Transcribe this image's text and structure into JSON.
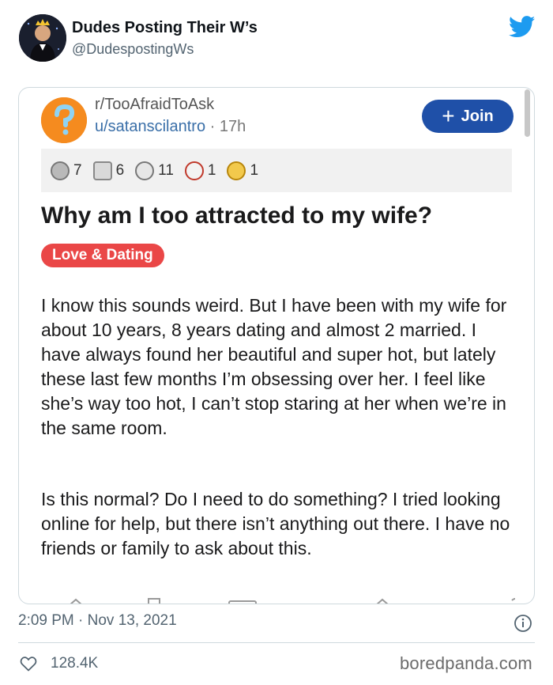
{
  "author": {
    "name": "Dudes Posting Their W’s",
    "handle": "@DudespostingWs"
  },
  "embedded_post": {
    "subreddit": "r/TooAfraidToAsk",
    "username": "u/satanscilantro",
    "separator": "·",
    "age": "17h",
    "join_label": "Join",
    "awards": [
      {
        "icon": "silver-award-icon",
        "count": "7"
      },
      {
        "icon": "helpful-award-icon",
        "count": "6"
      },
      {
        "icon": "wholesome-award-icon",
        "count": "11"
      },
      {
        "icon": "doggo-award-icon",
        "count": "1"
      },
      {
        "icon": "gold-award-icon",
        "count": "1"
      }
    ],
    "title": "Why am I too attracted to my wife?",
    "flair": "Love & Dating",
    "paragraphs": [
      "I know this sounds weird. But I have been with my wife for about 10 years, 8 years dating and almost 2 married. I have always found her beautiful and super hot, but lately  these last few months I’m obsessing over her. I feel like she’s way too hot, I can’t stop staring at her when we’re in the same room.",
      "Is this normal? Do I need to do something? I tried looking online for help, but there isn’t anything out there. I have no friends or family to ask about this."
    ]
  },
  "footer": {
    "timestamp": "2:09 PM · Nov 13, 2021",
    "likes": "128.4K",
    "watermark": "boredpanda.com"
  },
  "colors": {
    "twitter_blue": "#1d9bf0",
    "join_button": "#1f50a8",
    "flair": "#ea4747",
    "username_link": "#3a6fa8"
  }
}
